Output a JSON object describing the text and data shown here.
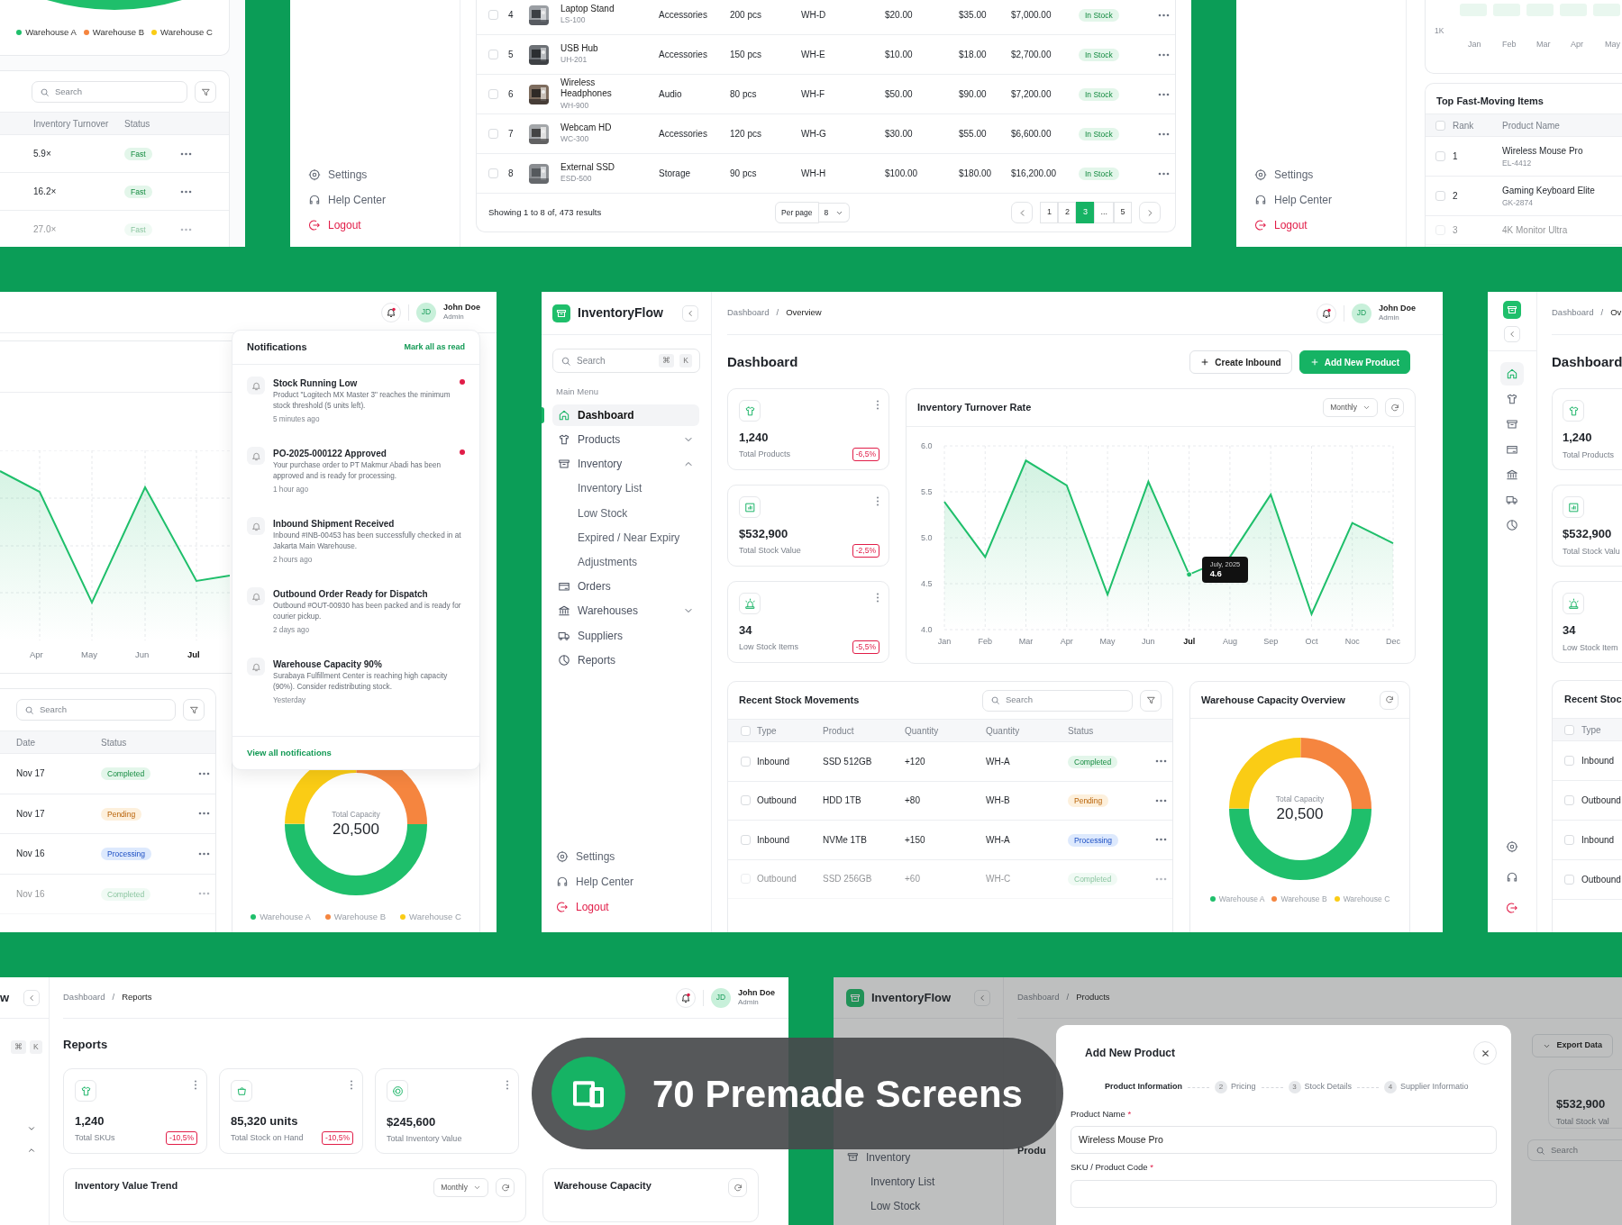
{
  "stock_turnover_screen": {
    "legend": [
      {
        "label": "Warehouse A",
        "color": "#1fbf6b"
      },
      {
        "label": "Warehouse B",
        "color": "#f5853f"
      },
      {
        "label": "Warehouse C",
        "color": "#facc15"
      }
    ],
    "search": {
      "placeholder": "Search"
    },
    "columns": [
      "Inventory Turnover",
      "Status"
    ],
    "rows": [
      {
        "turnover": "5.9×",
        "status": "Fast",
        "kind": "success",
        "faded": false
      },
      {
        "turnover": "16.2×",
        "status": "Fast",
        "kind": "success",
        "faded": false
      },
      {
        "turnover": "27.0×",
        "status": "Fast",
        "kind": "success",
        "faded": true
      }
    ]
  },
  "products_screen": {
    "sidebar_bottom": [
      {
        "label": "Settings",
        "kind": "settings"
      },
      {
        "label": "Help Center",
        "kind": "help"
      },
      {
        "label": "Logout",
        "kind": "logout"
      }
    ],
    "rows": [
      {
        "checked": false,
        "no": "4",
        "name": "Laptop Stand",
        "sku": "LS-100",
        "category": "Accessories",
        "stock": "200 pcs",
        "warehouse": "WH-D",
        "cost": "$20.00",
        "price": "$35.00",
        "total": "$7,000.00",
        "status": "In Stock",
        "kind": "success"
      },
      {
        "checked": false,
        "no": "5",
        "name": "USB Hub",
        "sku": "UH-201",
        "category": "Accessories",
        "stock": "150 pcs",
        "warehouse": "WH-E",
        "cost": "$10.00",
        "price": "$18.00",
        "total": "$2,700.00",
        "status": "In Stock",
        "kind": "success"
      },
      {
        "checked": false,
        "no": "6",
        "name": "Wireless Headphones",
        "sku": "WH-900",
        "category": "Audio",
        "stock": "80 pcs",
        "warehouse": "WH-F",
        "cost": "$50.00",
        "price": "$90.00",
        "total": "$7,200.00",
        "status": "In Stock",
        "kind": "success"
      },
      {
        "checked": false,
        "no": "7",
        "name": "Webcam HD",
        "sku": "WC-300",
        "category": "Accessories",
        "stock": "120 pcs",
        "warehouse": "WH-G",
        "cost": "$30.00",
        "price": "$55.00",
        "total": "$6,600.00",
        "status": "In Stock",
        "kind": "success"
      },
      {
        "checked": false,
        "no": "8",
        "name": "External SSD",
        "sku": "ESD-500",
        "category": "Storage",
        "stock": "90 pcs",
        "warehouse": "WH-H",
        "cost": "$100.00",
        "price": "$180.00",
        "total": "$16,200.00",
        "status": "In Stock",
        "kind": "success"
      }
    ],
    "footer": {
      "summary": "Showing 1 to 8 of, 473 results",
      "per_page_label": "Per page",
      "per_page": "8",
      "pages": [
        {
          "label": "1",
          "selected": false
        },
        {
          "label": "2",
          "selected": false
        },
        {
          "label": "3",
          "selected": true
        },
        {
          "label": "...",
          "selected": false
        },
        {
          "label": "5",
          "selected": false
        }
      ]
    }
  },
  "top_items_screen": {
    "sidebar_bottom": [
      {
        "label": "Settings",
        "kind": "settings"
      },
      {
        "label": "Help Center",
        "kind": "help"
      },
      {
        "label": "Logout",
        "kind": "logout"
      }
    ],
    "chart_axis": {
      "y_label": "1K",
      "months": [
        "Jan",
        "Feb",
        "Mar",
        "Apr",
        "May"
      ]
    },
    "title": "Top Fast-Moving Items",
    "all_checked": false,
    "columns": [
      "Rank",
      "Product Name"
    ],
    "rows": [
      {
        "checked": false,
        "rank": "1",
        "name": "Wireless Mouse Pro",
        "sku": "EL-4412",
        "faded": false
      },
      {
        "checked": false,
        "rank": "2",
        "name": "Gaming Keyboard Elite",
        "sku": "GK-2874",
        "faded": false
      },
      {
        "checked": false,
        "rank": "3",
        "name": "4K Monitor Ultra",
        "faded": true
      }
    ]
  },
  "notifications_screen": {
    "user": {
      "initials": "JD",
      "name": "John Doe",
      "role": "Admin"
    },
    "chart_months": [
      {
        "label": "Apr",
        "selected": false
      },
      {
        "label": "May",
        "selected": false
      },
      {
        "label": "Jun",
        "selected": false
      },
      {
        "label": "Jul",
        "selected": true
      }
    ],
    "search": {
      "placeholder": "Search"
    },
    "columns": [
      "Date",
      "Status"
    ],
    "rows": [
      {
        "date": "Nov 17",
        "status": "Completed",
        "kind": "success",
        "faded": false
      },
      {
        "date": "Nov 17",
        "status": "Pending",
        "kind": "warning",
        "faded": false
      },
      {
        "date": "Nov 16",
        "status": "Processing",
        "kind": "info",
        "faded": false
      },
      {
        "date": "Nov 16",
        "status": "Completed",
        "kind": "success",
        "faded": true
      }
    ],
    "capacity": {
      "label": "Total Capacity",
      "value": "20,500",
      "legend": [
        {
          "label": "Warehouse A",
          "color": "#1fbf6b"
        },
        {
          "label": "Warehouse B",
          "color": "#f5853f"
        },
        {
          "label": "Warehouse C",
          "color": "#facc15"
        }
      ]
    },
    "notifications": {
      "title": "Notifications",
      "action": "Mark all as read",
      "footer": "View all notifications",
      "items": [
        {
          "title": "Stock Running Low",
          "body": "Product \"Logitech MX Master 3\" reaches the minimum stock threshold (5 units left).",
          "time": "5 minutes ago",
          "unread": true
        },
        {
          "title": "PO-2025-000122 Approved",
          "body": "Your purchase order to PT Makmur Abadi has been approved and is ready for processing.",
          "time": "1 hour ago",
          "unread": true
        },
        {
          "title": "Inbound Shipment Received",
          "body": "Inbound #INB-00453 has been successfully checked in at Jakarta Main Warehouse.",
          "time": "2 hours ago",
          "unread": false
        },
        {
          "title": "Outbound Order Ready for Dispatch",
          "body": "Outbound #OUT-00930 has been packed and is ready for courier pickup.",
          "time": "2 days ago",
          "unread": false
        },
        {
          "title": "Warehouse Capacity 90%",
          "body": "Surabaya Fulfillment Center is reaching high capacity (90%). Consider redistributing stock.",
          "time": "Yesterday",
          "unread": false
        }
      ]
    }
  },
  "dashboard_screen": {
    "brand": "InventoryFlow",
    "search": {
      "placeholder": "Search",
      "keys": [
        "⌘",
        "K"
      ]
    },
    "menu_label": "Main Menu",
    "nav": [
      {
        "label": "Dashboard",
        "selected": true
      },
      {
        "label": "Products",
        "selected": false,
        "expanded": false
      },
      {
        "label": "Inventory",
        "selected": false,
        "expanded": true,
        "children": [
          {
            "label": "Inventory List",
            "selected": false
          },
          {
            "label": "Low Stock",
            "selected": false
          },
          {
            "label": "Expired / Near Expiry",
            "selected": false
          },
          {
            "label": "Adjustments",
            "selected": false
          }
        ]
      },
      {
        "label": "Orders",
        "selected": false
      },
      {
        "label": "Warehouses",
        "selected": false,
        "expanded": false
      },
      {
        "label": "Suppliers",
        "selected": false
      },
      {
        "label": "Reports",
        "selected": false
      }
    ],
    "sidebar_bottom": [
      {
        "label": "Settings",
        "kind": "settings"
      },
      {
        "label": "Help Center",
        "kind": "help"
      },
      {
        "label": "Logout",
        "kind": "logout"
      }
    ],
    "breadcrumb": {
      "items": [
        "Dashboard",
        "Overview"
      ],
      "separator": "/"
    },
    "user": {
      "initials": "JD",
      "name": "John Doe",
      "role": "Admin"
    },
    "title": "Dashboard",
    "actions": [
      {
        "label": "Create Inbound",
        "kind": "outline"
      },
      {
        "label": "Add New Product",
        "kind": "primary"
      }
    ],
    "stats": [
      {
        "value": "1,240",
        "label": "Total Products",
        "change": "-6,5%"
      },
      {
        "value": "$532,900",
        "label": "Total Stock Value",
        "change": "-2,5%"
      },
      {
        "value": "34",
        "label": "Low Stock Items",
        "change": "-5,5%"
      }
    ],
    "turnover": {
      "title": "Inventory Turnover Rate",
      "period": "Monthly",
      "tooltip": {
        "category": "Jul",
        "title": "July, 2025",
        "value": "4.6"
      },
      "chart_data": {
        "type": "area",
        "grid": true,
        "categories": [
          "Jan",
          "Feb",
          "Mar",
          "Apr",
          "May",
          "Jun",
          "Jul",
          "Aug",
          "Sep",
          "Oct",
          "Noc",
          "Dec"
        ],
        "series": [
          {
            "color": "#1fbf6b",
            "values": [
              5.39,
              4.79,
              5.84,
              5.57,
              4.38,
              5.61,
              4.6,
              4.79,
              5.47,
              4.17,
              5.16,
              4.94
            ]
          }
        ],
        "ylim": [
          4,
          6
        ],
        "yticks": [
          {
            "value": 4,
            "label": "4.0"
          },
          {
            "value": 4.5,
            "label": "4.5"
          },
          {
            "value": 5,
            "label": "5.0"
          },
          {
            "value": 5.5,
            "label": "5.5"
          },
          {
            "value": 6,
            "label": "6.0"
          }
        ]
      }
    },
    "movements": {
      "title": "Recent Stock Movements",
      "search": {
        "placeholder": "Search"
      },
      "all_checked": false,
      "columns": [
        "Type",
        "Product",
        "Quantity",
        "Quantity",
        "Status"
      ],
      "rows": [
        {
          "checked": false,
          "type": "Inbound",
          "product": "SSD 512GB",
          "quantity": "+120",
          "warehouse": "WH-A",
          "status": "Completed",
          "kind": "success",
          "faded": false
        },
        {
          "checked": false,
          "type": "Outbound",
          "product": "HDD 1TB",
          "quantity": "+80",
          "warehouse": "WH-B",
          "status": "Pending",
          "kind": "warning",
          "faded": false
        },
        {
          "checked": false,
          "type": "Inbound",
          "product": "NVMe 1TB",
          "quantity": "+150",
          "warehouse": "WH-A",
          "status": "Processing",
          "kind": "info",
          "faded": false
        },
        {
          "checked": false,
          "type": "Outbound",
          "product": "SSD 256GB",
          "quantity": "+60",
          "warehouse": "WH-C",
          "status": "Completed",
          "kind": "success",
          "faded": true
        }
      ]
    },
    "capacity": {
      "title": "Warehouse Capacity Overview",
      "label": "Total Capacity",
      "value": "20,500",
      "legend": [
        {
          "label": "Warehouse A",
          "color": "#1fbf6b"
        },
        {
          "label": "Warehouse B",
          "color": "#f5853f"
        },
        {
          "label": "Warehouse C",
          "color": "#facc15"
        }
      ]
    }
  },
  "collapsed_screen": {
    "rail": [
      {
        "selected": true
      },
      {
        "selected": false
      },
      {
        "selected": false
      },
      {
        "selected": false
      },
      {
        "selected": false
      },
      {
        "selected": false
      },
      {
        "selected": false
      }
    ],
    "rail_bottom": [
      {
        "kind": "settings"
      },
      {
        "kind": "help"
      },
      {
        "kind": "logout"
      }
    ],
    "breadcrumb": {
      "items": [
        "Dashboard",
        "Ov"
      ],
      "separator": "/"
    },
    "title": "Dashboard",
    "stats": [
      {
        "value": "1,240",
        "label": "Total Products"
      },
      {
        "value": "$532,900",
        "label": "Total Stock Valu"
      },
      {
        "value": "34",
        "label": "Low Stock Item"
      }
    ],
    "table_title": "Recent Stoc",
    "all_checked": false,
    "column": "Type",
    "rows": [
      {
        "checked": false,
        "type": "Inbound"
      },
      {
        "checked": false,
        "type": "Outbound"
      },
      {
        "checked": false,
        "type": "Inbound"
      },
      {
        "checked": false,
        "type": "Outbound"
      }
    ]
  },
  "reports_screen": {
    "sidebar": {
      "brand_tail": "w",
      "keys": [
        "⌘",
        "K"
      ],
      "groups": [
        {
          "expanded": false
        },
        {
          "expanded": true
        }
      ]
    },
    "breadcrumb": {
      "items": [
        "Dashboard",
        "Reports"
      ],
      "separator": "/"
    },
    "user": {
      "initials": "JD",
      "name": "John Doe",
      "role": "Admin"
    },
    "title": "Reports",
    "stats": [
      {
        "value": "1,240",
        "label": "Total SKUs",
        "change": "-10,5%"
      },
      {
        "value": "85,320 units",
        "label": "Total Stock on Hand",
        "change": "-10,5%"
      },
      {
        "value": "$245,600",
        "label": "Total Inventory Value"
      }
    ],
    "trend": {
      "title": "Inventory Value Trend",
      "period": "Monthly"
    },
    "capacity_title": "Warehouse Capacity"
  },
  "add_product_screen": {
    "brand": "InventoryFlow",
    "breadcrumb": {
      "items": [
        "Dashboard",
        "Products"
      ],
      "separator": "/"
    },
    "nav": [
      "Inventory",
      "Inventory List",
      "Low Stock"
    ],
    "export": "Export Data",
    "stat": {
      "value": "$532,900",
      "label": "Total Stock Val"
    },
    "section": "Produ",
    "search": {
      "placeholder": "Search"
    },
    "modal": {
      "title": "Add New Product",
      "steps": [
        {
          "label": "Product Information",
          "selected": true
        },
        {
          "number": "2",
          "label": "Pricing",
          "selected": false
        },
        {
          "number": "3",
          "label": "Stock Details",
          "selected": false
        },
        {
          "number": "4",
          "label": "Supplier Informatio",
          "selected": false
        }
      ],
      "fields": [
        {
          "label": "Product Name",
          "required_mark": "*",
          "value": "Wireless Mouse Pro"
        },
        {
          "label": "SKU / Product Code",
          "required_mark": "*"
        }
      ]
    }
  },
  "promo_badge": {
    "title": "70 Premade Screens"
  }
}
